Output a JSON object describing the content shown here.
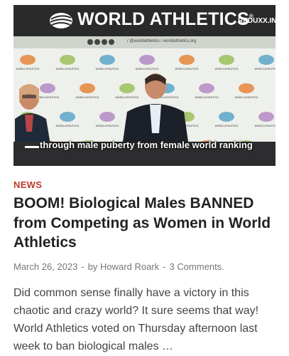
{
  "video": {
    "banner_title": "WORLD ATHLETICS",
    "banner_trademark": "®",
    "watermark": "REDUXX.INFO",
    "social_text": "/ @worldathletics  /  worldathletics.org",
    "backdrop_logo_caption": "WORLD ATHLETICS",
    "caption": "through male puberty from female world ranking"
  },
  "article": {
    "category": "NEWS",
    "headline": "BOOM! Biological Males BANNED from Competing as Women in World Athletics",
    "date": "March 26, 2023",
    "author_prefix": "by",
    "author": "Howard Roark",
    "comments": "3 Comments.",
    "excerpt": "Did common sense finally have a victory in this chaotic and crazy world? It sure seems that way! World Athletics voted on Thursday afternoon last week to ban biological males …"
  },
  "colors": {
    "category": "#c0392b",
    "banner": "#2a2a2a",
    "headline": "#222222"
  }
}
